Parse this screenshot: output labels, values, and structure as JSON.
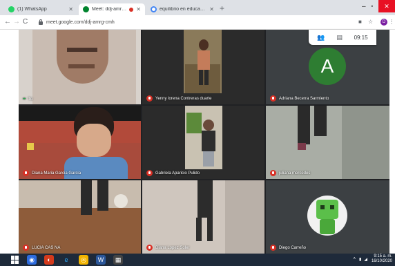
{
  "browser": {
    "tabs": [
      {
        "label": "(1) WhatsApp",
        "favicon_color": "#25d366"
      },
      {
        "label": "Meet: ddj-amrg-cmh",
        "favicon_color": "#00832d",
        "active": true
      },
      {
        "label": "equilibrio en educacion fisica - G",
        "favicon_color": "#4285f4"
      }
    ],
    "new_tab": "+",
    "url": "meet.google.com/ddj-amrg-cmh",
    "profile_initial": "D"
  },
  "meet": {
    "clock": "09:15",
    "participants": [
      {
        "name": "Tú",
        "muted": false
      },
      {
        "name": "Yenny lorena Contreras duarte",
        "muted": true
      },
      {
        "name": "Adriana Becerra Sarmiento",
        "muted": true,
        "avatar_letter": "A",
        "avatar_color": "#2e7d32"
      },
      {
        "name": "Diana Maria Garcia Garcia",
        "muted": true
      },
      {
        "name": "Gabriela Aparicio Pulido",
        "muted": true
      },
      {
        "name": "juliana mercedes",
        "muted": true
      },
      {
        "name": "LUCIA CAS NA",
        "muted": true
      },
      {
        "name": "Diana Lopez Soler",
        "muted": true
      },
      {
        "name": "Diego Carreño",
        "muted": true
      }
    ]
  },
  "taskbar": {
    "time": "9:15 a. m.",
    "date": "16/10/2020"
  }
}
